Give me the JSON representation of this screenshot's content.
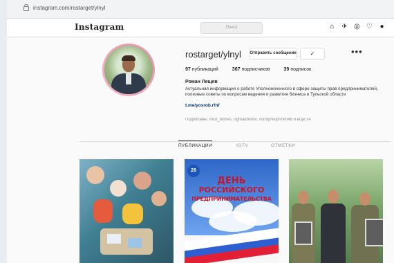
{
  "browser": {
    "url": "instagram.com/rostarget/ylnyl"
  },
  "ig": {
    "logo": "Instagram",
    "search_placeholder": "Поиск"
  },
  "profile": {
    "username": "rostarget/ylnyl",
    "message_button": "Отправить сообщение",
    "follow_button": "✓",
    "more": "•••",
    "stats": [
      {
        "value": "97",
        "label": "публикаций"
      },
      {
        "value": "367",
        "label": "подписчиков"
      },
      {
        "value": "39",
        "label": "подписок"
      }
    ],
    "full_name": "Роман Лещев",
    "bio": "Актуальная информация о работе Уполномоченного в сфере защиты прав предпринимателей, полезные советы по вопросам ведения и развития бизнеса в Тульской области",
    "link": "t.me/yosrob.rfnf",
    "followed_by": "Подписаны: irkut_bisnes, ogfnadbiorel, vorotpredprinim46 и еще 14"
  },
  "tabs": [
    {
      "label": "ПУБЛИКАЦИИ",
      "active": true
    },
    {
      "label": "IGTV",
      "active": false
    },
    {
      "label": "ОТМЕТКИ",
      "active": false
    }
  ],
  "posts": [
    {
      "alt": "children craft class photo"
    },
    {
      "title_line1": "ДЕНЬ",
      "title_line2": "РОССИЙСКОГО",
      "title_line3": "ПРЕДПРИНИМАТЕЛЬСТВА",
      "badge": "26"
    },
    {
      "alt": "group with portraits in military uniforms"
    }
  ]
}
